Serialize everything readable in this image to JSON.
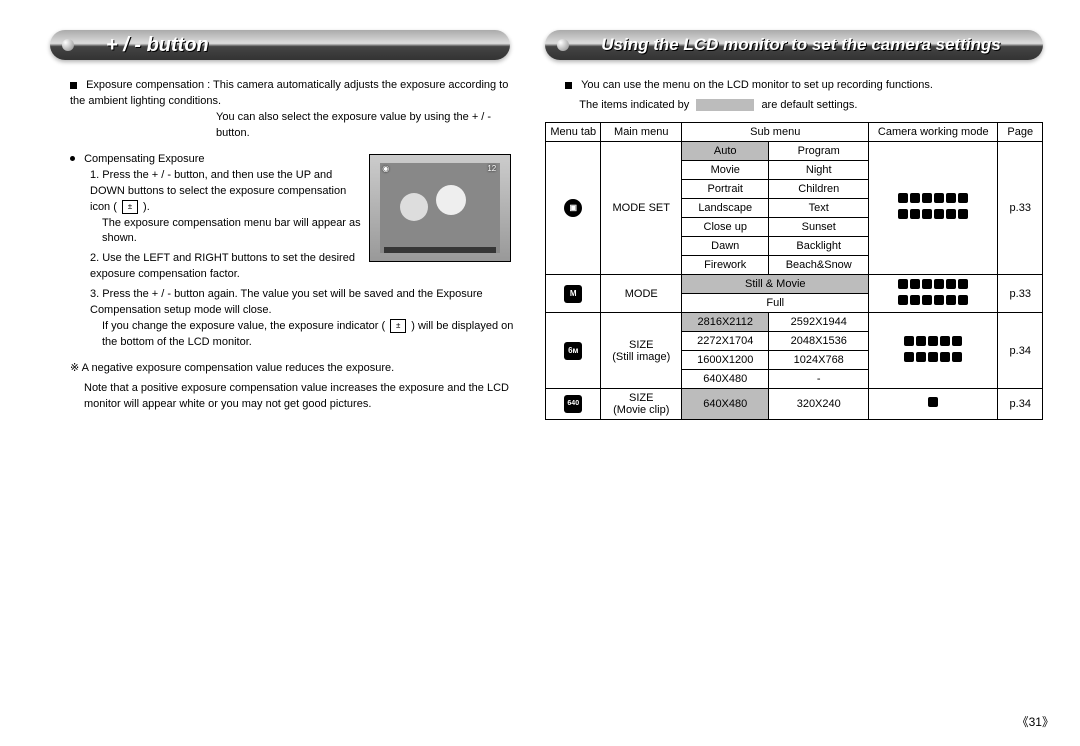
{
  "left": {
    "heading": "+ / - button",
    "intro_label": "Exposure compensation : ",
    "intro_text1": "This camera automatically adjusts the exposure according to the ambient lighting conditions.",
    "intro_text2": "You can also select the exposure value by using the + / - button.",
    "comp_heading": "Compensating Exposure",
    "step1a": "1. Press the + / - button, and then use the UP and DOWN buttons to select the exposure compensation icon ( ",
    "step1b": " ).",
    "step1c": "The exposure compensation menu bar will appear as shown.",
    "step2": "2. Use the LEFT and RIGHT buttons to set the desired exposure compensation factor.",
    "step3a": "3. Press the + / - button again. The value you set will be saved and the Exposure Compensation setup mode will close.",
    "step3b": "If you change the exposure value, the exposure indicator ( ",
    "step3c": " ) will be displayed on the bottom of the LCD monitor.",
    "note1": "A negative exposure compensation value reduces the exposure.",
    "note2": "Note that a positive exposure compensation value increases the exposure and the LCD monitor will appear white or you may not get good pictures."
  },
  "right": {
    "heading": "Using the LCD monitor to set the camera settings",
    "intro1": "You can use the menu on the LCD monitor to set up recording functions.",
    "intro2a": "The items indicated by",
    "intro2b": "are default settings.",
    "table": {
      "headers": [
        "Menu tab",
        "Main menu",
        "Sub menu",
        "Camera working mode",
        "Page"
      ],
      "rows": [
        {
          "tab": "camera",
          "main": "MODE SET",
          "sub": [
            [
              "Auto",
              "Program",
              true
            ],
            [
              "Movie",
              "Night",
              false
            ],
            [
              "Portrait",
              "Children",
              false
            ],
            [
              "Landscape",
              "Text",
              false
            ],
            [
              "Close up",
              "Sunset",
              false
            ],
            [
              "Dawn",
              "Backlight",
              false
            ],
            [
              "Firework",
              "Beach&Snow",
              false
            ]
          ],
          "page": "p.33"
        },
        {
          "tab": "M",
          "main": "MODE",
          "sub": [
            [
              "Still & Movie",
              "",
              true,
              true
            ],
            [
              "Full",
              "",
              false,
              true
            ]
          ],
          "page": "p.33"
        },
        {
          "tab": "6M",
          "main": [
            "SIZE",
            "(Still image)"
          ],
          "sub": [
            [
              "2816X2112",
              "2592X1944",
              true
            ],
            [
              "2272X1704",
              "2048X1536",
              false
            ],
            [
              "1600X1200",
              "1024X768",
              false
            ],
            [
              "640X480",
              "-",
              false
            ]
          ],
          "page": "p.34"
        },
        {
          "tab": "640",
          "main": [
            "SIZE",
            "(Movie clip)"
          ],
          "sub": [
            [
              "640X480",
              "320X240",
              true
            ]
          ],
          "page": "p.34",
          "mode_single": true
        }
      ]
    }
  },
  "page_number": "31"
}
